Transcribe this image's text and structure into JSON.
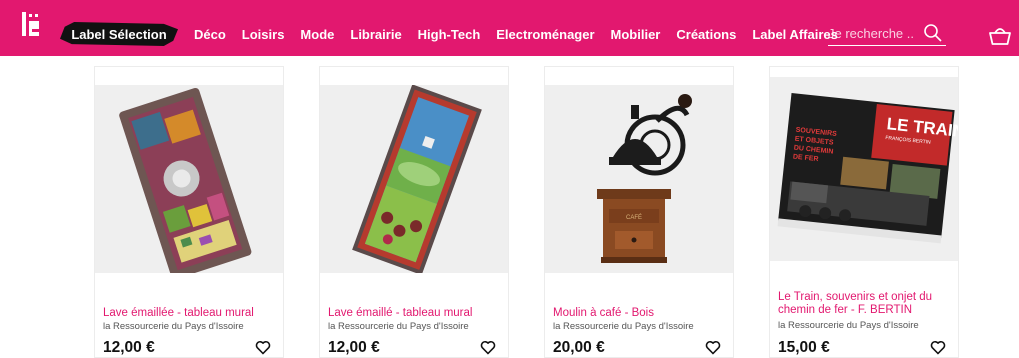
{
  "header": {
    "logo_text": "lë",
    "label_selection": "Label Sélection",
    "nav": [
      "Déco",
      "Loisirs",
      "Mode",
      "Librairie",
      "High-Tech",
      "Electroménager",
      "Mobilier",
      "Créations",
      "Label Affaires"
    ],
    "search_placeholder": "Je recherche ...",
    "search_icon": "search-icon",
    "cart_icon": "basket-icon"
  },
  "colors": {
    "brand": "#e2186f",
    "label_bg": "#111111",
    "price": "#111111"
  },
  "products": [
    {
      "title": "Lave émaillée - tableau mural",
      "seller": "la Ressourcerie du Pays d'Issoire",
      "price": "12,00 €",
      "fav_icon": "heart-icon"
    },
    {
      "title": "Lave émaillé - tableau mural",
      "seller": "la Ressourcerie du Pays d'Issoire",
      "price": "12,00 €",
      "fav_icon": "heart-icon"
    },
    {
      "title": "Moulin à café - Bois",
      "seller": "la Ressourcerie du Pays d'Issoire",
      "price": "20,00 €",
      "fav_icon": "heart-icon"
    },
    {
      "title": "Le Train, souvenirs et onjet du chemin de fer - F. BERTIN",
      "title_line1": "Le Train, souvenirs et onjet du",
      "title_line2": "chemin de fer - F. BERTIN",
      "seller": "la Ressourcerie du Pays d'Issoire",
      "price": "15,00 €",
      "fav_icon": "heart-icon"
    }
  ],
  "images": {
    "box_label": "CAFÉ",
    "book_title": "LE TRAIN",
    "book_author": "FRANÇOIS BERTIN",
    "book_subtitle_1": "SOUVENIRS",
    "book_subtitle_2": "ET OBJETS",
    "book_subtitle_3": "DU CHEMIN",
    "book_subtitle_4": "DE FER"
  }
}
